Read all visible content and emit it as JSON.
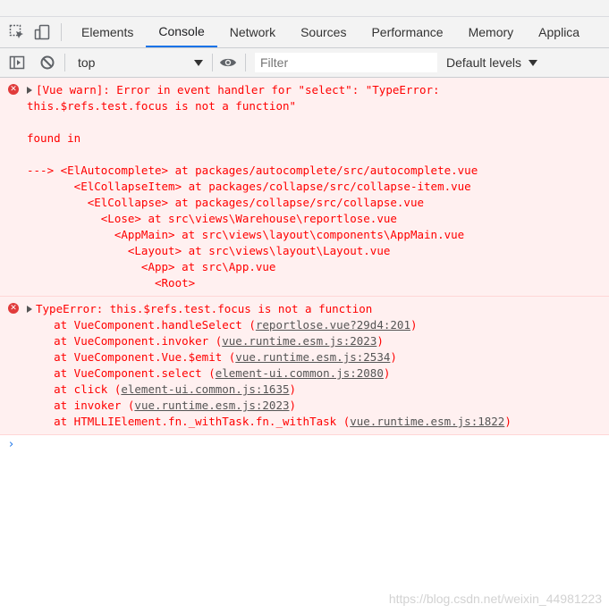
{
  "tabs": [
    {
      "label": "Elements"
    },
    {
      "label": "Console"
    },
    {
      "label": "Network"
    },
    {
      "label": "Sources"
    },
    {
      "label": "Performance"
    },
    {
      "label": "Memory"
    },
    {
      "label": "Applica"
    }
  ],
  "toolbar": {
    "context": "top",
    "filter_placeholder": "Filter",
    "levels": "Default levels"
  },
  "messages": {
    "warn": {
      "lines": [
        "[Vue warn]: Error in event handler for \"select\": \"TypeError:",
        "this.$refs.test.focus is not a function\"",
        "",
        "found in",
        "",
        "---> <ElAutocomplete> at packages/autocomplete/src/autocomplete.vue",
        "       <ElCollapseItem> at packages/collapse/src/collapse-item.vue",
        "         <ElCollapse> at packages/collapse/src/collapse.vue",
        "           <Lose> at src\\views\\Warehouse\\reportlose.vue",
        "             <AppMain> at src\\views\\layout\\components\\AppMain.vue",
        "               <Layout> at src\\views\\layout\\Layout.vue",
        "                 <App> at src\\App.vue",
        "                   <Root>"
      ]
    },
    "error": {
      "title": "TypeError: this.$refs.test.focus is not a function",
      "stack": [
        {
          "prefix": "    at VueComponent.handleSelect (",
          "link": "reportlose.vue?29d4:201",
          "suffix": ")"
        },
        {
          "prefix": "    at VueComponent.invoker (",
          "link": "vue.runtime.esm.js:2023",
          "suffix": ")"
        },
        {
          "prefix": "    at VueComponent.Vue.$emit (",
          "link": "vue.runtime.esm.js:2534",
          "suffix": ")"
        },
        {
          "prefix": "    at VueComponent.select (",
          "link": "element-ui.common.js:2080",
          "suffix": ")"
        },
        {
          "prefix": "    at click (",
          "link": "element-ui.common.js:1635",
          "suffix": ")"
        },
        {
          "prefix": "    at invoker (",
          "link": "vue.runtime.esm.js:2023",
          "suffix": ")"
        },
        {
          "prefix": "    at HTMLLIElement.fn._withTask.fn._withTask (",
          "link": "vue.runtime.esm.js:1822",
          "suffix": ")"
        }
      ]
    }
  },
  "prompt": "›",
  "watermark": "https://blog.csdn.net/weixin_44981223"
}
